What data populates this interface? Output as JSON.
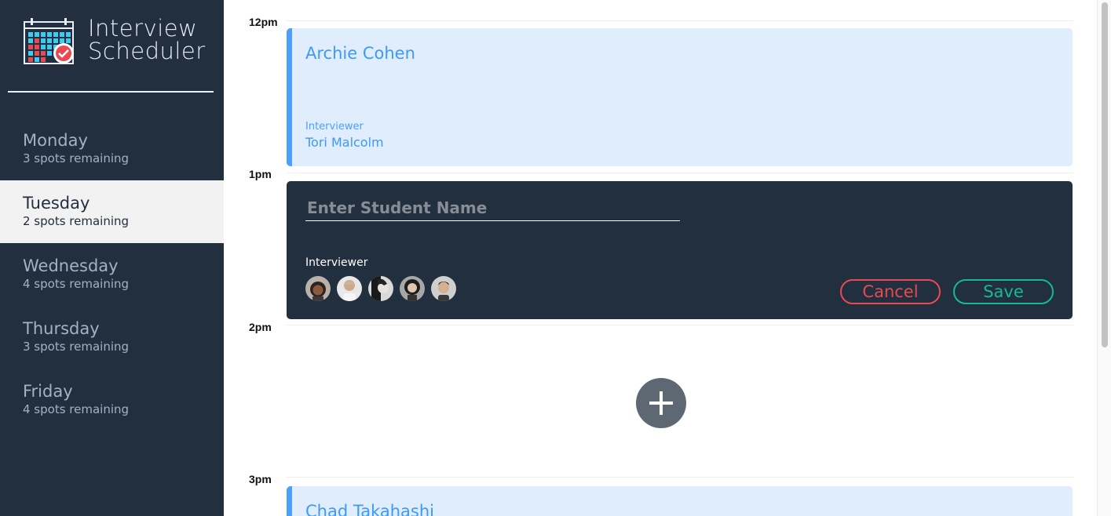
{
  "brand": {
    "line1": "Interview",
    "line2": "Scheduler"
  },
  "days": [
    {
      "name": "Monday",
      "spots": "3 spots remaining",
      "selected": false
    },
    {
      "name": "Tuesday",
      "spots": "2 spots remaining",
      "selected": true
    },
    {
      "name": "Wednesday",
      "spots": "4 spots remaining",
      "selected": false
    },
    {
      "name": "Thursday",
      "spots": "3 spots remaining",
      "selected": false
    },
    {
      "name": "Friday",
      "spots": "4 spots remaining",
      "selected": false
    }
  ],
  "times": [
    "12pm",
    "1pm",
    "2pm",
    "3pm"
  ],
  "appointment_12pm": {
    "student": "Archie Cohen",
    "interviewer_label": "Interviewer",
    "interviewer": "Tori Malcolm"
  },
  "form": {
    "student_placeholder": "Enter Student Name",
    "student_value": "",
    "interviewer_label": "Interviewer",
    "cancel_label": "Cancel",
    "save_label": "Save"
  },
  "appointment_3pm": {
    "student": "Chad Takahashi"
  },
  "colors": {
    "sidebar": "#222f3e",
    "accent_blue": "#4d9ffe",
    "card_bg": "#e0edfc",
    "danger": "#e84a53",
    "success": "#17b894",
    "add_button": "#5e6872"
  },
  "icons": {
    "logo": "calendar-check-icon",
    "add": "plus-icon"
  }
}
